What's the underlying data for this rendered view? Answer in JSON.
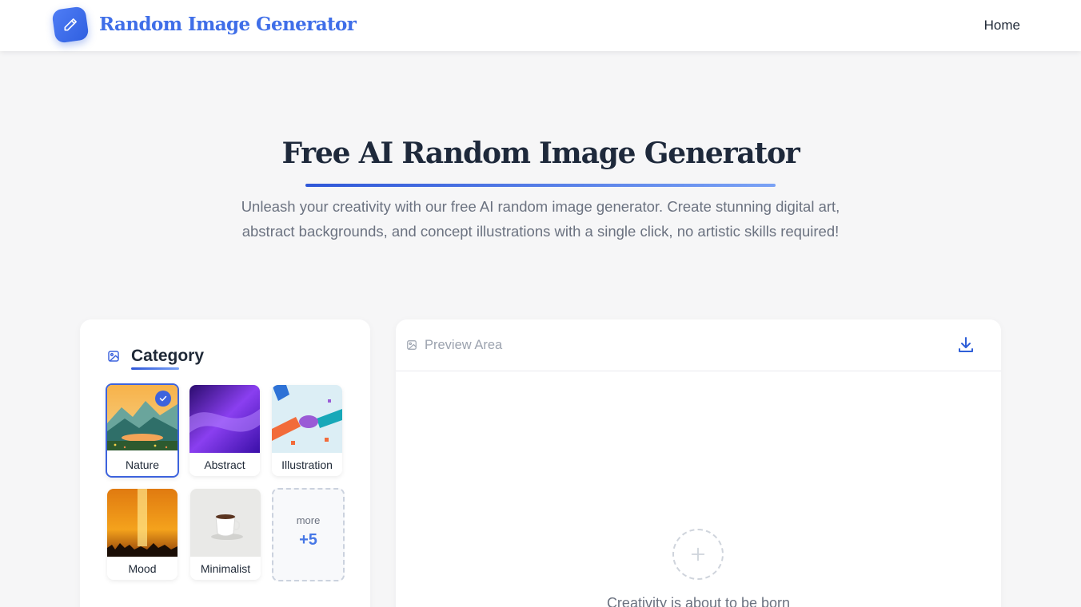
{
  "header": {
    "brand": "Random Image Generator",
    "nav": {
      "home": "Home"
    }
  },
  "hero": {
    "title": "Free AI Random Image Generator",
    "subtitle": "Unleash your creativity with our free AI random image generator. Create stunning digital art, abstract backgrounds, and concept illustrations with a single click, no artistic skills required!"
  },
  "category": {
    "title": "Category",
    "items": [
      {
        "label": "Nature",
        "selected": true
      },
      {
        "label": "Abstract",
        "selected": false
      },
      {
        "label": "Illustration",
        "selected": false
      },
      {
        "label": "Mood",
        "selected": false
      },
      {
        "label": "Minimalist",
        "selected": false
      }
    ],
    "more": {
      "text": "more",
      "count": "+5"
    }
  },
  "preview": {
    "title": "Preview Area",
    "empty_message": "Creativity is about to be born"
  },
  "colors": {
    "accent": "#3d63dd",
    "brand": "#3f6ee8",
    "title": "#1e293b",
    "muted": "#6b7280"
  },
  "icons": {
    "logo": "pencil-icon",
    "category": "image-icon",
    "preview": "image-icon",
    "download": "download-icon",
    "selected": "check-icon",
    "empty": "plus-icon"
  }
}
